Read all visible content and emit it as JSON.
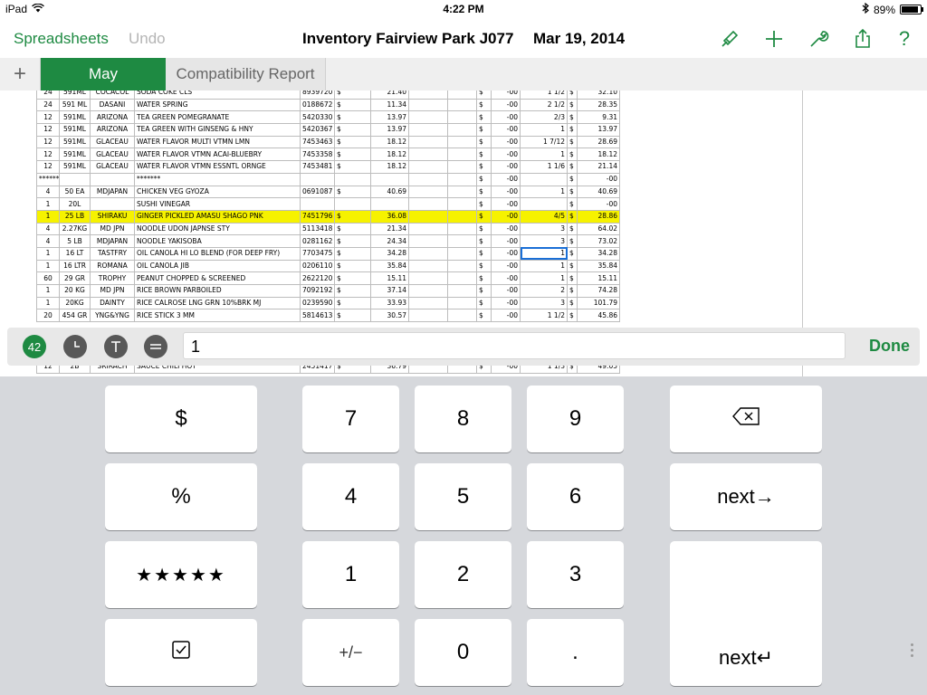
{
  "status": {
    "device": "iPad",
    "time": "4:22 PM",
    "battery": "89%",
    "battery_level": 0.89
  },
  "nav": {
    "back_label": "Spreadsheets",
    "undo_label": "Undo",
    "title": "Inventory Fairview Park  J077",
    "date": "Mar 19, 2014"
  },
  "tabs": {
    "add_label": "+",
    "items": [
      {
        "label": "May"
      },
      {
        "label": "Compatibility Report"
      }
    ]
  },
  "sheet": {
    "rows": [
      [
        "24",
        "591ML",
        "COCACOL",
        "SODA COKE CLS",
        "8939720",
        "$",
        "21.40",
        "",
        "",
        "$",
        "-00",
        "1 1/2",
        "$",
        "32.10"
      ],
      [
        "24",
        "591 ML",
        "DASANI",
        "WATER SPRING",
        "0188672",
        "$",
        "11.34",
        "",
        "",
        "$",
        "-00",
        "2 1/2",
        "$",
        "28.35"
      ],
      [
        "12",
        "591ML",
        "ARIZONA",
        "TEA GREEN POMEGRANATE",
        "5420330",
        "$",
        "13.97",
        "",
        "",
        "$",
        "-00",
        "2/3",
        "$",
        "9.31"
      ],
      [
        "12",
        "591ML",
        "ARIZONA",
        "TEA GREEN WITH GINSENG & HNY",
        "5420367",
        "$",
        "13.97",
        "",
        "",
        "$",
        "-00",
        "1",
        "$",
        "13.97"
      ],
      [
        "12",
        "591ML",
        "GLACEAU",
        "WATER FLAVOR MULTI VTMN LMN",
        "7453463",
        "$",
        "18.12",
        "",
        "",
        "$",
        "-00",
        "1 7/12",
        "$",
        "28.69"
      ],
      [
        "12",
        "591ML",
        "GLACEAU",
        "WATER FLAVOR VTMN ACAI-BLUEBRY",
        "7453358",
        "$",
        "18.12",
        "",
        "",
        "$",
        "-00",
        "1",
        "$",
        "18.12"
      ],
      [
        "12",
        "591ML",
        "GLACEAU",
        "WATER FLAVOR VTMN ESSNTL ORNGE",
        "7453481",
        "$",
        "18.12",
        "",
        "",
        "$",
        "-00",
        "1 1/6",
        "$",
        "21.14"
      ],
      [
        "*******GROCERY",
        "",
        "",
        "*******",
        "",
        "",
        "",
        "",
        "",
        "$",
        "-00",
        "",
        "$",
        "-00"
      ],
      [
        "4",
        "50 EA",
        "MDJAPAN",
        "CHICKEN VEG GYOZA",
        "0691087",
        "$",
        "40.69",
        "",
        "",
        "$",
        "-00",
        "1",
        "$",
        "40.69"
      ],
      [
        "1",
        "20L",
        "",
        "SUSHI VINEGAR",
        "",
        "",
        "",
        "",
        "",
        "$",
        "-00",
        "",
        "$",
        "-00"
      ],
      [
        "1",
        "25 LB",
        "SHIRAKU",
        "GINGER PICKLED AMASU SHAGO PNK",
        "7451796",
        "$",
        "36.08",
        "",
        "",
        "$",
        "-00",
        "4/5",
        "$",
        "28.86"
      ],
      [
        "4",
        "2.27KG",
        "MD JPN",
        "NOODLE UDON JAPNSE STY",
        "5113418",
        "$",
        "21.34",
        "",
        "",
        "$",
        "-00",
        "3",
        "$",
        "64.02"
      ],
      [
        "4",
        "5 LB",
        "MDJAPAN",
        "NOODLE YAKISOBA",
        "0281162",
        "$",
        "24.34",
        "",
        "",
        "$",
        "-00",
        "3",
        "$",
        "73.02"
      ],
      [
        "1",
        "16 LT",
        "TASTFRY",
        "OIL CANOLA HI LO BLEND (FOR DEEP FRY)",
        "7703475",
        "$",
        "34.28",
        "",
        "",
        "$",
        "-00",
        "1",
        "$",
        "34.28"
      ],
      [
        "1",
        "16 LTR",
        "ROMANA",
        "OIL CANOLA JIB",
        "0206110",
        "$",
        "35.84",
        "",
        "",
        "$",
        "-00",
        "1",
        "$",
        "35.84"
      ],
      [
        "60",
        "29 GR",
        "TROPHY",
        "PEANUT CHOPPED & SCREENED",
        "2622120",
        "$",
        "15.11",
        "",
        "",
        "$",
        "-00",
        "1",
        "$",
        "15.11"
      ],
      [
        "1",
        "20 KG",
        "MD JPN",
        "RICE BROWN PARBOILED",
        "7092192",
        "$",
        "37.14",
        "",
        "",
        "$",
        "-00",
        "2",
        "$",
        "74.28"
      ],
      [
        "1",
        "20KG",
        "DAINTY",
        "RICE CALROSE LNG GRN 10%BRK MJ",
        "0239590",
        "$",
        "33.93",
        "",
        "",
        "$",
        "-00",
        "3",
        "$",
        "101.79"
      ],
      [
        "20",
        "454 GR",
        "YNG&YNG",
        "RICE STICK 3 MM",
        "5814613",
        "$",
        "30.57",
        "",
        "",
        "$",
        "-00",
        "1 1/2",
        "$",
        "45.86"
      ]
    ],
    "partial_row": [
      "12",
      "2B",
      "SRIRACH",
      "SAUCE CHILI HOT",
      "2451417",
      "$",
      "36.79",
      "",
      "",
      "$",
      "-00",
      "1 1/3",
      "$",
      "49.05"
    ]
  },
  "formula_bar": {
    "icon_42": "42",
    "value": "1",
    "done_label": "Done"
  },
  "keyboard": {
    "dollar": "$",
    "percent": "%",
    "stars": "★★★★★",
    "checkbox": "☑",
    "plusminus": "+/−",
    "next_right": "next→",
    "next_return": "next↵",
    "digits": [
      "7",
      "8",
      "9",
      "4",
      "5",
      "6",
      "1",
      "2",
      "3",
      "0",
      "."
    ]
  },
  "colors": {
    "accent": "#1e8a42",
    "highlight_row": "#f6f200",
    "selection": "#1a6fd6"
  }
}
